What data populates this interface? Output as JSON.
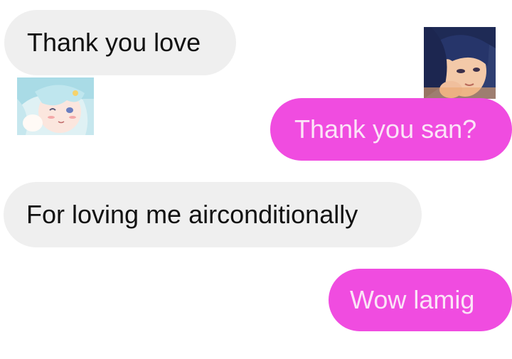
{
  "conversation": {
    "messages": [
      {
        "sender": "friend",
        "text": "Thank you love"
      },
      {
        "sender": "me",
        "text": "Thank you san?"
      },
      {
        "sender": "friend",
        "text": "For loving me airconditionally"
      },
      {
        "sender": "me",
        "text": "Wow lamig"
      }
    ],
    "avatars": {
      "left": {
        "icon": "anime-girl-avatar-icon"
      },
      "right": {
        "icon": "anime-boy-avatar-icon"
      }
    },
    "colors": {
      "incoming_bubble": "#efefef",
      "outgoing_bubble": "#f04ce0",
      "outgoing_text": "#fbe4f7"
    }
  }
}
